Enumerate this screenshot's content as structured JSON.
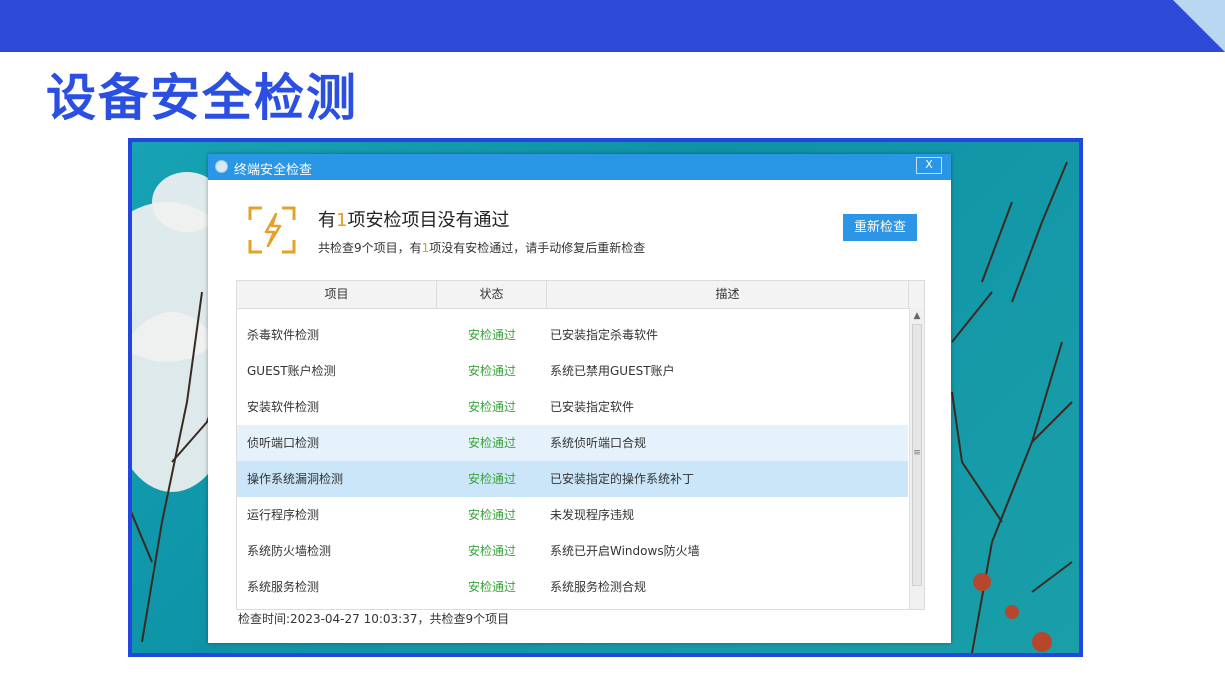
{
  "slide": {
    "title": "设备安全检测"
  },
  "dialog": {
    "title": "终端安全检查",
    "close_label": "X",
    "headline_prefix": "有",
    "headline_count": "1",
    "headline_suffix": "项安检项目没有通过",
    "sub_prefix": "共检查9个项目，有",
    "sub_count": "1",
    "sub_suffix": "项没有安检通过，请手动修复后重新检查",
    "recheck_label": "重新检查",
    "columns": [
      "项目",
      "状态",
      "描述"
    ],
    "rows": [
      {
        "name": "杀毒软件检测",
        "status": "安检通过",
        "desc": "已安装指定杀毒软件"
      },
      {
        "name": "GUEST账户检测",
        "status": "安检通过",
        "desc": "系统已禁用GUEST账户"
      },
      {
        "name": "安装软件检测",
        "status": "安检通过",
        "desc": "已安装指定软件"
      },
      {
        "name": "侦听端口检测",
        "status": "安检通过",
        "desc": "系统侦听端口合规"
      },
      {
        "name": "操作系统漏洞检测",
        "status": "安检通过",
        "desc": "已安装指定的操作系统补丁"
      },
      {
        "name": "运行程序检测",
        "status": "安检通过",
        "desc": "未发现程序违规"
      },
      {
        "name": "系统防火墙检测",
        "status": "安检通过",
        "desc": "系统已开启Windows防火墙"
      },
      {
        "name": "系统服务检测",
        "status": "安检通过",
        "desc": "系统服务检测合规"
      }
    ],
    "footer": "检查时间:2023-04-27 10:03:37，共检查9个项目"
  },
  "colors": {
    "brand_blue": "#2d4bd8",
    "accent_orange": "#e79a1b",
    "pass_green": "#39a23a",
    "button_blue": "#2c95e6"
  }
}
